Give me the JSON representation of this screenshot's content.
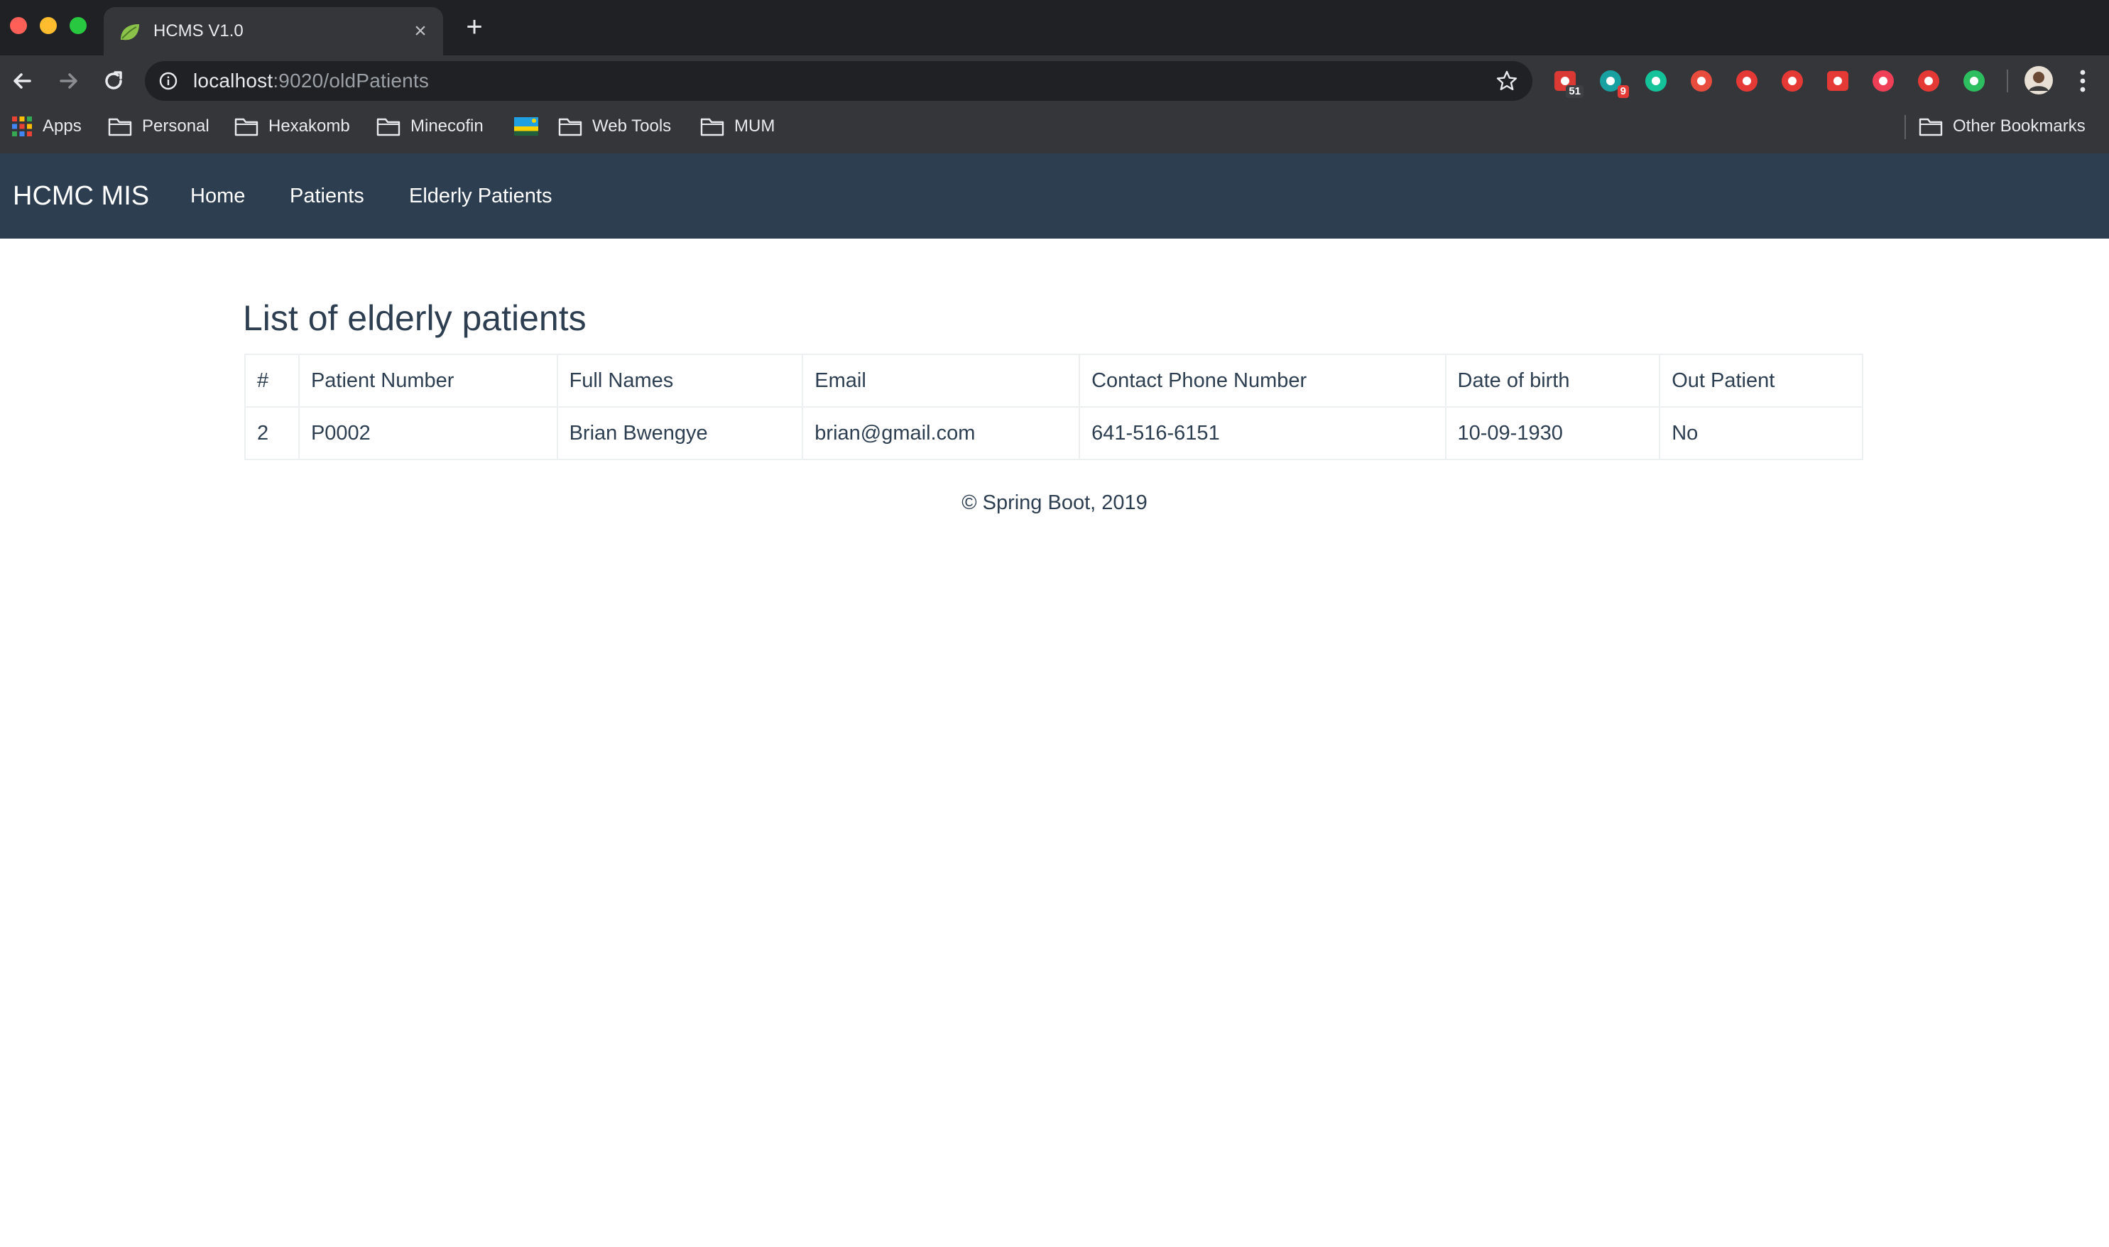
{
  "browser": {
    "tab_title": "HCMS V1.0",
    "url_host": "localhost",
    "url_path": ":9020/oldPatients",
    "extensions": [
      {
        "icon": "calendar-ext-icon",
        "badge": "51",
        "color": "#db3a34"
      },
      {
        "icon": "app-ext-icon",
        "badge": "9",
        "color": "#19a0a0"
      },
      {
        "icon": "grammarly-icon",
        "color": "#15c39a"
      },
      {
        "icon": "color-wheel-icon",
        "color": "#e84c3d"
      },
      {
        "icon": "adblock-icon",
        "color": "#e53935"
      },
      {
        "icon": "stop-hand-icon",
        "color": "#e53935"
      },
      {
        "icon": "shield-ext-icon",
        "color": "#e53935"
      },
      {
        "icon": "pocket-icon",
        "color": "#ef3f56"
      },
      {
        "icon": "close-circle-ext-icon",
        "color": "#e53935"
      },
      {
        "icon": "evernote-icon",
        "color": "#2dbe60"
      }
    ],
    "bookmarks": [
      "Apps",
      "Personal",
      "Hexakomb",
      "Minecofin",
      "Web Tools",
      "MUM"
    ],
    "other_bookmarks": "Other Bookmarks"
  },
  "navbar": {
    "brand": "HCMC MIS",
    "links": [
      "Home",
      "Patients",
      "Elderly Patients"
    ]
  },
  "page": {
    "title": "List of elderly patients",
    "table": {
      "headers": [
        "#",
        "Patient Number",
        "Full Names",
        "Email",
        "Contact Phone Number",
        "Date of birth",
        "Out Patient"
      ],
      "rows": [
        [
          "2",
          "P0002",
          "Brian Bwengye",
          "brian@gmail.com",
          "641-516-6151",
          "10-09-1930",
          "No"
        ]
      ]
    },
    "footer": "© Spring Boot, 2019"
  },
  "colors": {
    "navbar_bg": "#2c3e50",
    "text": "#2c3e50",
    "table_border": "#ecf0f1"
  }
}
